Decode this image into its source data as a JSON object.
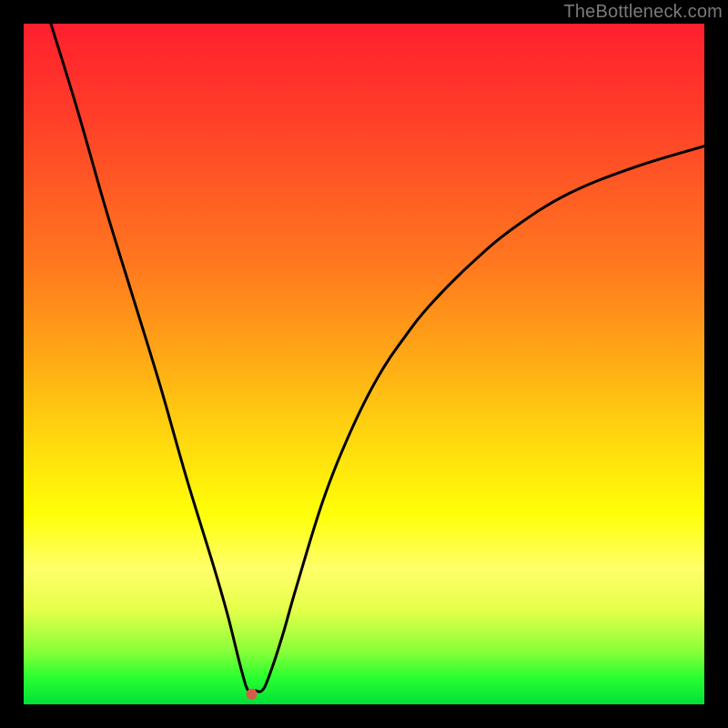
{
  "watermark": {
    "text": "TheBottleneck.com"
  },
  "chart_data": {
    "type": "line",
    "title": "",
    "xlabel": "",
    "ylabel": "",
    "xlim": [
      0,
      100
    ],
    "ylim": [
      0,
      100
    ],
    "grid": false,
    "legend": false,
    "marker": {
      "x": 33.5,
      "y": 1.5,
      "color": "#d85a4a",
      "r": 6
    },
    "series": [
      {
        "name": "curve",
        "color": "#000000",
        "x": [
          4,
          8,
          12,
          16,
          20,
          24,
          28,
          30,
          32,
          33,
          34,
          35,
          36,
          38,
          40,
          44,
          48,
          52,
          56,
          60,
          66,
          72,
          80,
          90,
          100
        ],
        "y": [
          100,
          87,
          73,
          60,
          47,
          33,
          20,
          13,
          5,
          2,
          2,
          2,
          4,
          10,
          17,
          30,
          40,
          48,
          54,
          59,
          65,
          70,
          75,
          79,
          82
        ]
      }
    ]
  }
}
